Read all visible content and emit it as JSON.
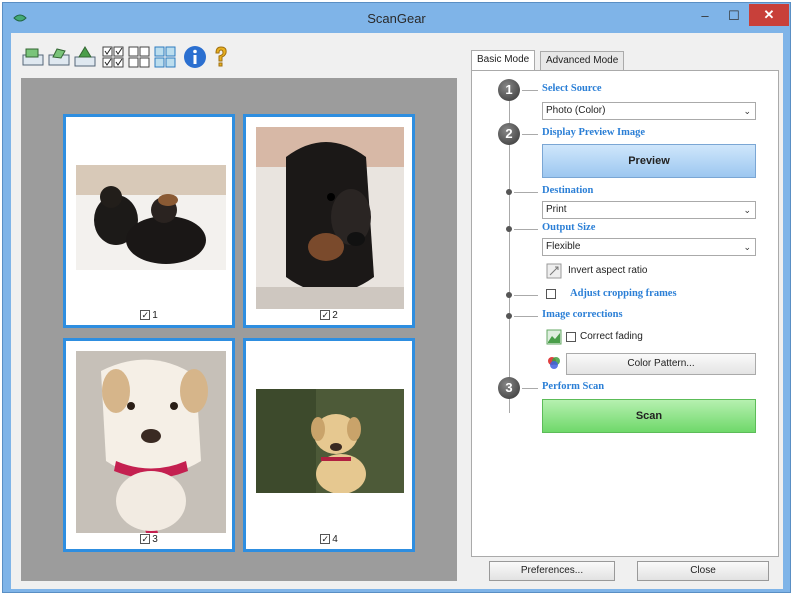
{
  "window": {
    "title": "ScanGear",
    "minimize_glyph": "–",
    "maximize_glyph": "☐",
    "close_glyph": "✕"
  },
  "toolbar": {
    "icons": [
      "scan-icon",
      "scan-rotate-icon",
      "scan-crop-icon",
      "select-all-icon",
      "deselect-all-icon",
      "thumbnail-view-icon",
      "info-icon",
      "help-icon"
    ]
  },
  "preview": {
    "thumbnails": [
      {
        "label": "1",
        "checked": true
      },
      {
        "label": "2",
        "checked": true
      },
      {
        "label": "3",
        "checked": true
      },
      {
        "label": "4",
        "checked": true
      }
    ],
    "check_glyph": "✓"
  },
  "tabs": {
    "basic": "Basic Mode",
    "advanced": "Advanced Mode"
  },
  "steps": {
    "one": "1",
    "two": "2",
    "three": "3"
  },
  "basic_mode": {
    "select_source_label": "Select Source",
    "source_value": "Photo (Color)",
    "display_preview_label": "Display Preview Image",
    "preview_button": "Preview",
    "destination_label": "Destination",
    "destination_value": "Print",
    "output_size_label": "Output Size",
    "output_size_value": "Flexible",
    "invert_aspect_ratio": "Invert aspect ratio",
    "adjust_cropping_frames": "Adjust cropping frames",
    "image_corrections_label": "Image corrections",
    "correct_fading": "Correct fading",
    "color_pattern_button": "Color Pattern...",
    "perform_scan_label": "Perform Scan",
    "scan_button": "Scan",
    "dropdown_arrow": "⌄"
  },
  "footer": {
    "preferences_button": "Preferences...",
    "close_button": "Close"
  },
  "colors": {
    "window_frame": "#7fb4e8",
    "accent_blue": "#2b7fd6",
    "thumbnail_border": "#2e8ee0",
    "close_red": "#c8403a",
    "scan_green": "#6fd86a",
    "preview_blue": "#9cc7f0"
  }
}
